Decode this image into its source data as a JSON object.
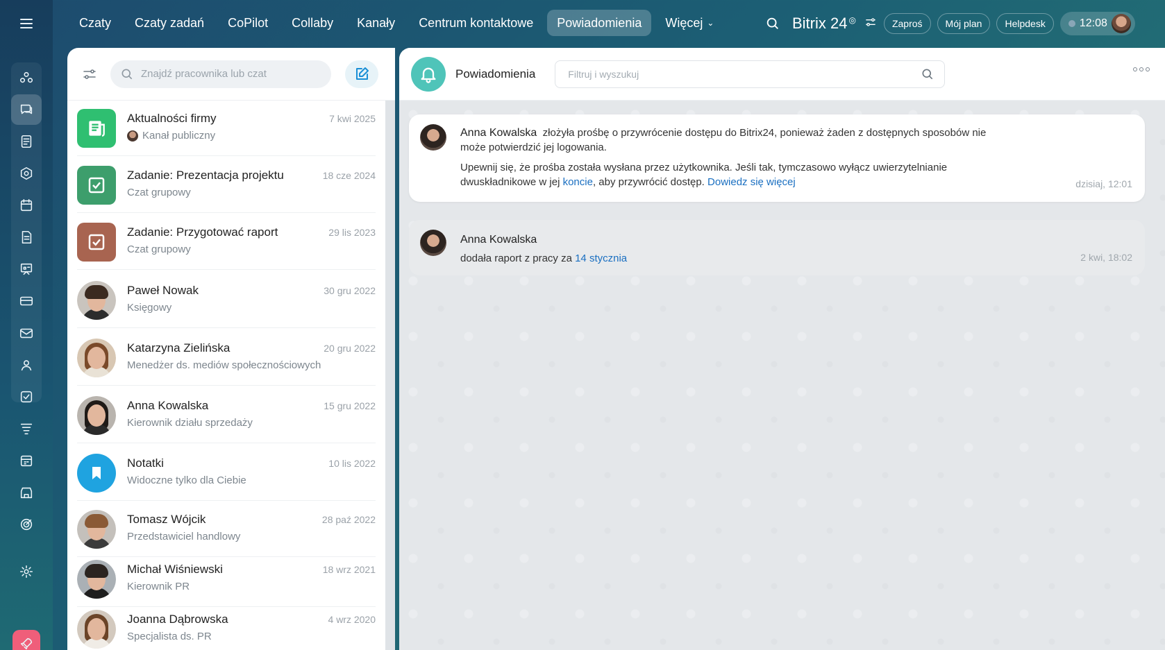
{
  "nav": {
    "items": [
      "Czaty",
      "Czaty zadań",
      "CoPilot",
      "Collaby",
      "Kanały",
      "Centrum kontaktowe",
      "Powiadomienia",
      "Więcej"
    ],
    "active": "Powiadomienia"
  },
  "header": {
    "brand": "Bitrix 24",
    "invite": "Zaproś",
    "plan": "Mój plan",
    "helpdesk": "Helpdesk",
    "time": "12:08"
  },
  "chatlist": {
    "search_placeholder": "Znajdź pracownika lub czat",
    "items": [
      {
        "name": "Aktualności firmy",
        "sub": "Kanał publiczny",
        "date": "7 kwi 2025"
      },
      {
        "name": "Zadanie: Prezentacja projektu",
        "sub": "Czat grupowy",
        "date": "18 cze 2024"
      },
      {
        "name": "Zadanie: Przygotować raport",
        "sub": "Czat grupowy",
        "date": "29 lis 2023"
      },
      {
        "name": "Paweł Nowak",
        "sub": "Księgowy",
        "date": "30 gru 2022"
      },
      {
        "name": "Katarzyna Zielińska",
        "sub": "Menedżer ds. mediów społecznościowych",
        "date": "20 gru 2022"
      },
      {
        "name": "Anna Kowalska",
        "sub": "Kierownik działu sprzedaży",
        "date": "15 gru 2022"
      },
      {
        "name": "Notatki",
        "sub": "Widoczne tylko dla Ciebie",
        "date": "10 lis 2022"
      },
      {
        "name": "Tomasz Wójcik",
        "sub": "Przedstawiciel handlowy",
        "date": "28 paź 2022"
      },
      {
        "name": "Michał Wiśniewski",
        "sub": "Kierownik PR",
        "date": "18 wrz 2021"
      },
      {
        "name": "Joanna Dąbrowska",
        "sub": "Specjalista ds. PR",
        "date": "4 wrz 2020"
      }
    ]
  },
  "notifications": {
    "title": "Powiadomienia",
    "filter_placeholder": "Filtruj i wyszukuj",
    "cards": [
      {
        "author": "Anna Kowalska",
        "line1": "złożyła prośbę o przywrócenie dostępu do Bitrix24, ponieważ żaden z dostępnych sposobów nie może potwierdzić jej logowania.",
        "line2_a": "Upewnij się, że prośba została wysłana przez użytkownika. Jeśli tak, tymczasowo wyłącz uwierzytelnianie dwuskładnikowe w jej",
        "link1": "koncie",
        "line2_b": ", aby przywrócić dostęp.",
        "link2": "Dowiedz się więcej",
        "date": "dzisiaj, 12:01"
      },
      {
        "author": "Anna Kowalska",
        "text": "dodała raport z pracy za",
        "link": "14 stycznia",
        "date": "2 kwi, 18:02"
      }
    ]
  },
  "colors": {
    "accent": "#4fc4b9",
    "link": "#1a6fc1",
    "rocket": "#ef5e7a"
  },
  "icons": {
    "rail": [
      "collaboration-icon",
      "chat-icon",
      "feed-icon",
      "sites-icon",
      "calendar-icon",
      "document-icon",
      "board-icon",
      "card-icon",
      "mail-icon",
      "users-icon",
      "tasks-icon",
      "funnel-icon",
      "schedule-icon",
      "store-icon",
      "target-icon",
      "settings-icon",
      "rocket-icon"
    ]
  }
}
